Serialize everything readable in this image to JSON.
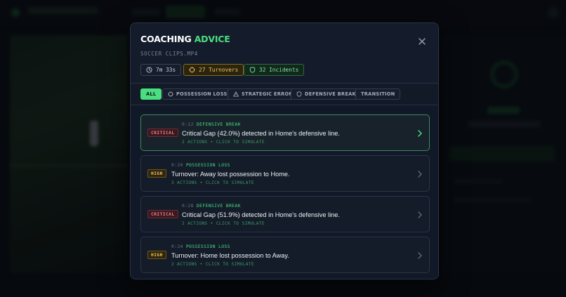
{
  "modal": {
    "title_prefix": "COACHING",
    "title_accent": "ADVICE",
    "close_icon": "close-icon",
    "file_name": "SOCCER CLIPS.MP4",
    "stats": {
      "duration": "7m 33s",
      "turnovers": "27 Turnovers",
      "incidents": "32 Incidents"
    },
    "filters": [
      {
        "label": "ALL",
        "icon": null,
        "active": true
      },
      {
        "label": "POSSESSION LOSS",
        "icon": "crosshair-icon",
        "active": false
      },
      {
        "label": "STRATEGIC ERROR",
        "icon": "warning-triangle-icon",
        "active": false
      },
      {
        "label": "DEFENSIVE BREAK",
        "icon": "shield-icon",
        "active": false
      },
      {
        "label": "TRANSITION",
        "icon": null,
        "active": false
      }
    ],
    "incidents": [
      {
        "severity": "CRITICAL",
        "time": "0:12",
        "category": "DEFENSIVE BREAK",
        "description": "Critical Gap (42.0%) detected in Home's defensive line.",
        "actions": "2 ACTIONS • CLICK TO SIMULATE",
        "selected": true
      },
      {
        "severity": "HIGH",
        "time": "0:20",
        "category": "POSSESSION LOSS",
        "description": "Turnover: Away lost possession to Home.",
        "actions": "3 ACTIONS • CLICK TO SIMULATE",
        "selected": false
      },
      {
        "severity": "CRITICAL",
        "time": "0:28",
        "category": "DEFENSIVE BREAK",
        "description": "Critical Gap (51.9%) detected in Home's defensive line.",
        "actions": "2 ACTIONS • CLICK TO SIMULATE",
        "selected": false
      },
      {
        "severity": "HIGH",
        "time": "0:34",
        "category": "POSSESSION LOSS",
        "description": "Turnover: Home lost possession to Away.",
        "actions": "2 ACTIONS • CLICK TO SIMULATE",
        "selected": false
      }
    ]
  },
  "colors": {
    "accent": "#4ade80",
    "critical": "#f07a8a",
    "high": "#f2c14e",
    "modal_bg": "#111827"
  }
}
